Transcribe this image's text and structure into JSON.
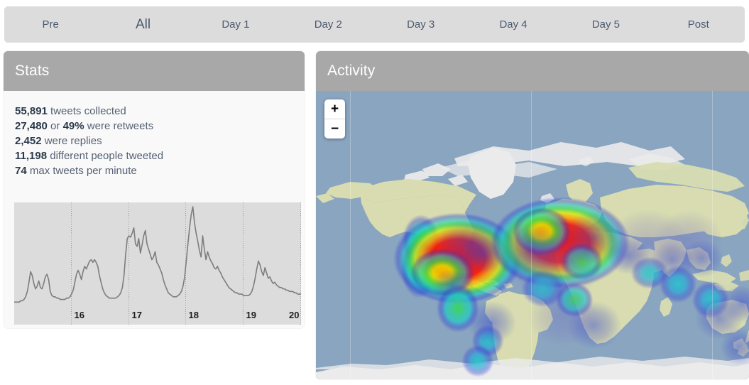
{
  "tabs": {
    "items": [
      {
        "label": "Pre",
        "selected": false
      },
      {
        "label": "All",
        "selected": true
      },
      {
        "label": "Day 1",
        "selected": false
      },
      {
        "label": "Day 2",
        "selected": false
      },
      {
        "label": "Day 3",
        "selected": false
      },
      {
        "label": "Day 4",
        "selected": false
      },
      {
        "label": "Day 5",
        "selected": false
      },
      {
        "label": "Post",
        "selected": false
      }
    ]
  },
  "stats": {
    "title": "Stats",
    "lines": [
      {
        "value": "55,891",
        "text": " tweets collected"
      },
      {
        "value": "27,480",
        "text": " or ",
        "value2": "49%",
        "text2": " were retweets"
      },
      {
        "value": "2,452",
        "text": " were replies"
      },
      {
        "value": "11,198",
        "text": " different people tweeted"
      },
      {
        "value": "74",
        "text": " max tweets per minute"
      }
    ]
  },
  "activity": {
    "title": "Activity",
    "zoom_in_label": "+",
    "zoom_out_label": "−"
  },
  "colors": {
    "page_bg": "#ffffff",
    "tabbar_bg": "#dcdcdc",
    "tab_text": "#4c5a6e",
    "panel_header_bg": "#a8a8a8",
    "panel_header_text": "#ffffff",
    "panel_body_bg": "#f9f9f9",
    "stat_number": "#2b3a4a",
    "stat_text": "#566173",
    "sparkline_bg": "#dcdcdc",
    "sparkline_stroke": "#7d7d7d",
    "gridline": "#9a9a9a",
    "map_ocean": "#8aa5c0",
    "map_land": "#d8dcb0",
    "map_ice": "#ebebeb",
    "heat_hot": "#ff0000",
    "heat_warm": "#ffa500",
    "heat_mid": "#3fd23f",
    "heat_cool": "#21d7d7",
    "heat_cold": "#2b2bd4"
  },
  "chart_data": {
    "type": "line",
    "title": "",
    "xlabel": "",
    "ylabel": "",
    "x_tick_labels": [
      "16",
      "17",
      "18",
      "19",
      "20"
    ],
    "x_tick_positions": [
      0.2,
      0.4,
      0.6,
      0.8,
      1.0
    ],
    "grid": true,
    "ylim": [
      0,
      74
    ],
    "values": [
      2,
      2,
      2,
      2,
      3,
      3,
      4,
      6,
      10,
      17,
      25,
      22,
      16,
      12,
      14,
      18,
      13,
      12,
      16,
      21,
      23,
      19,
      10,
      7,
      6,
      6,
      5,
      5,
      4,
      4,
      4,
      4,
      5,
      5,
      6,
      8,
      11,
      17,
      23,
      26,
      23,
      19,
      25,
      29,
      27,
      30,
      33,
      34,
      32,
      34,
      32,
      29,
      22,
      17,
      12,
      9,
      7,
      6,
      5,
      5,
      5,
      5,
      5,
      6,
      7,
      9,
      13,
      22,
      38,
      50,
      52,
      51,
      54,
      58,
      46,
      44,
      50,
      39,
      45,
      52,
      56,
      46,
      42,
      38,
      34,
      36,
      40,
      32,
      30,
      27,
      24,
      19,
      15,
      12,
      9,
      8,
      7,
      6,
      6,
      6,
      7,
      8,
      10,
      14,
      21,
      33,
      46,
      58,
      68,
      74,
      62,
      54,
      48,
      41,
      36,
      52,
      42,
      34,
      40,
      36,
      33,
      31,
      28,
      27,
      29,
      26,
      24,
      21,
      19,
      17,
      15,
      13,
      12,
      11,
      10,
      9,
      9,
      8,
      8,
      8,
      7,
      7,
      7,
      7,
      8,
      10,
      14,
      20,
      27,
      33,
      30,
      25,
      22,
      28,
      24,
      20,
      21,
      18,
      16,
      17,
      15,
      14,
      13,
      13,
      12,
      12,
      11,
      11,
      10,
      10,
      10,
      9,
      9,
      8,
      8,
      8
    ]
  }
}
